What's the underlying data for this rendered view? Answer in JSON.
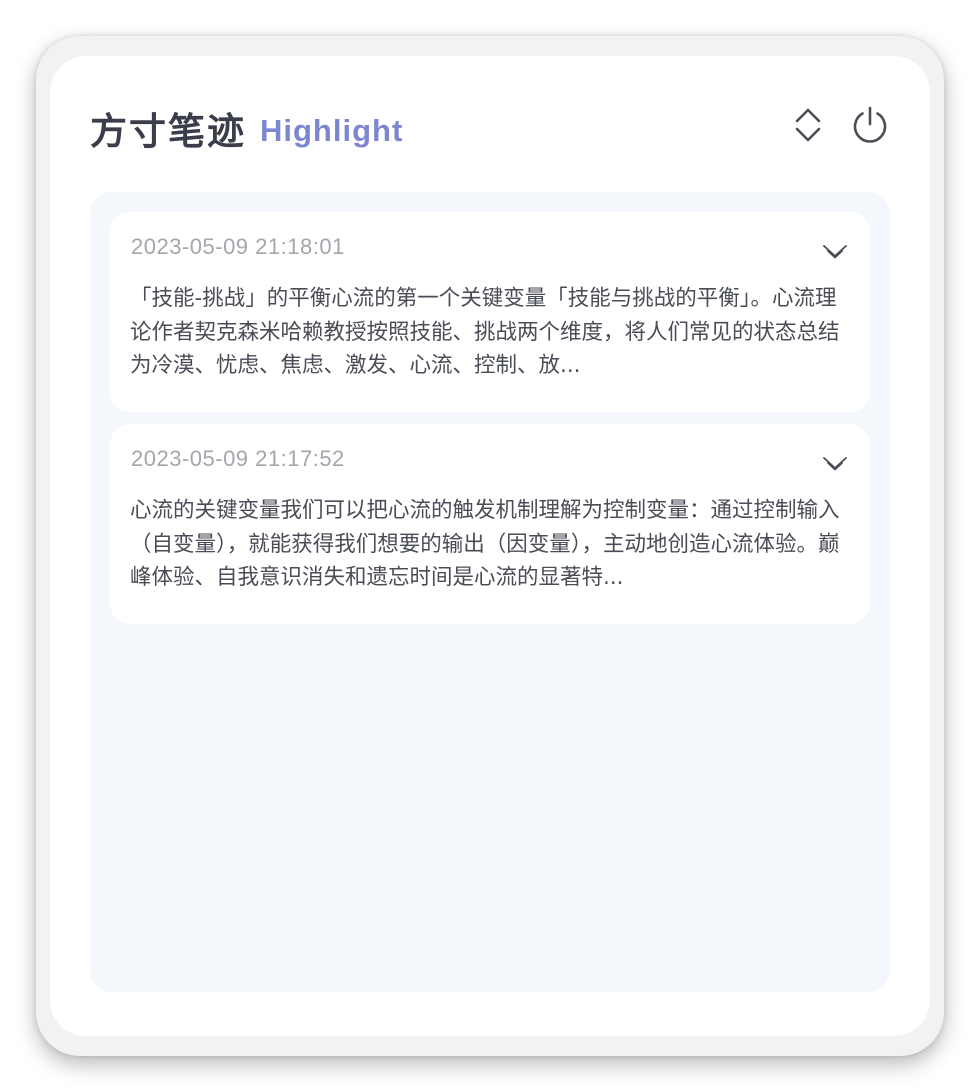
{
  "header": {
    "title": "方寸笔迹",
    "subtitle": "Highlight",
    "sort_icon": "chevron-up-down-icon",
    "power_icon": "power-icon"
  },
  "colors": {
    "accent": "#7d87cf",
    "title": "#3b3e4a",
    "list_bg": "#f4f7fc",
    "card_bg": "#ffffff",
    "muted_text": "#a3a6ad"
  },
  "highlights": [
    {
      "time": "2023-05-09 21:18:01",
      "text": "「技能-挑战」的平衡心流的第一个关键变量「技能与挑战的平衡」。心流理论作者契克森米哈赖教授按照技能、挑战两个维度，将人们常见的状态总结为冷漠、忧虑、焦虑、激发、心流、控制、放...",
      "expand_icon": "double-chevron-down-icon"
    },
    {
      "time": "2023-05-09 21:17:52",
      "text": "心流的关键变量我们可以把心流的触发机制理解为控制变量：通过控制输入（自变量），就能获得我们想要的输出（因变量），主动地创造心流体验。巅峰体验、自我意识消失和遗忘时间是心流的显著特...",
      "expand_icon": "double-chevron-down-icon"
    }
  ]
}
